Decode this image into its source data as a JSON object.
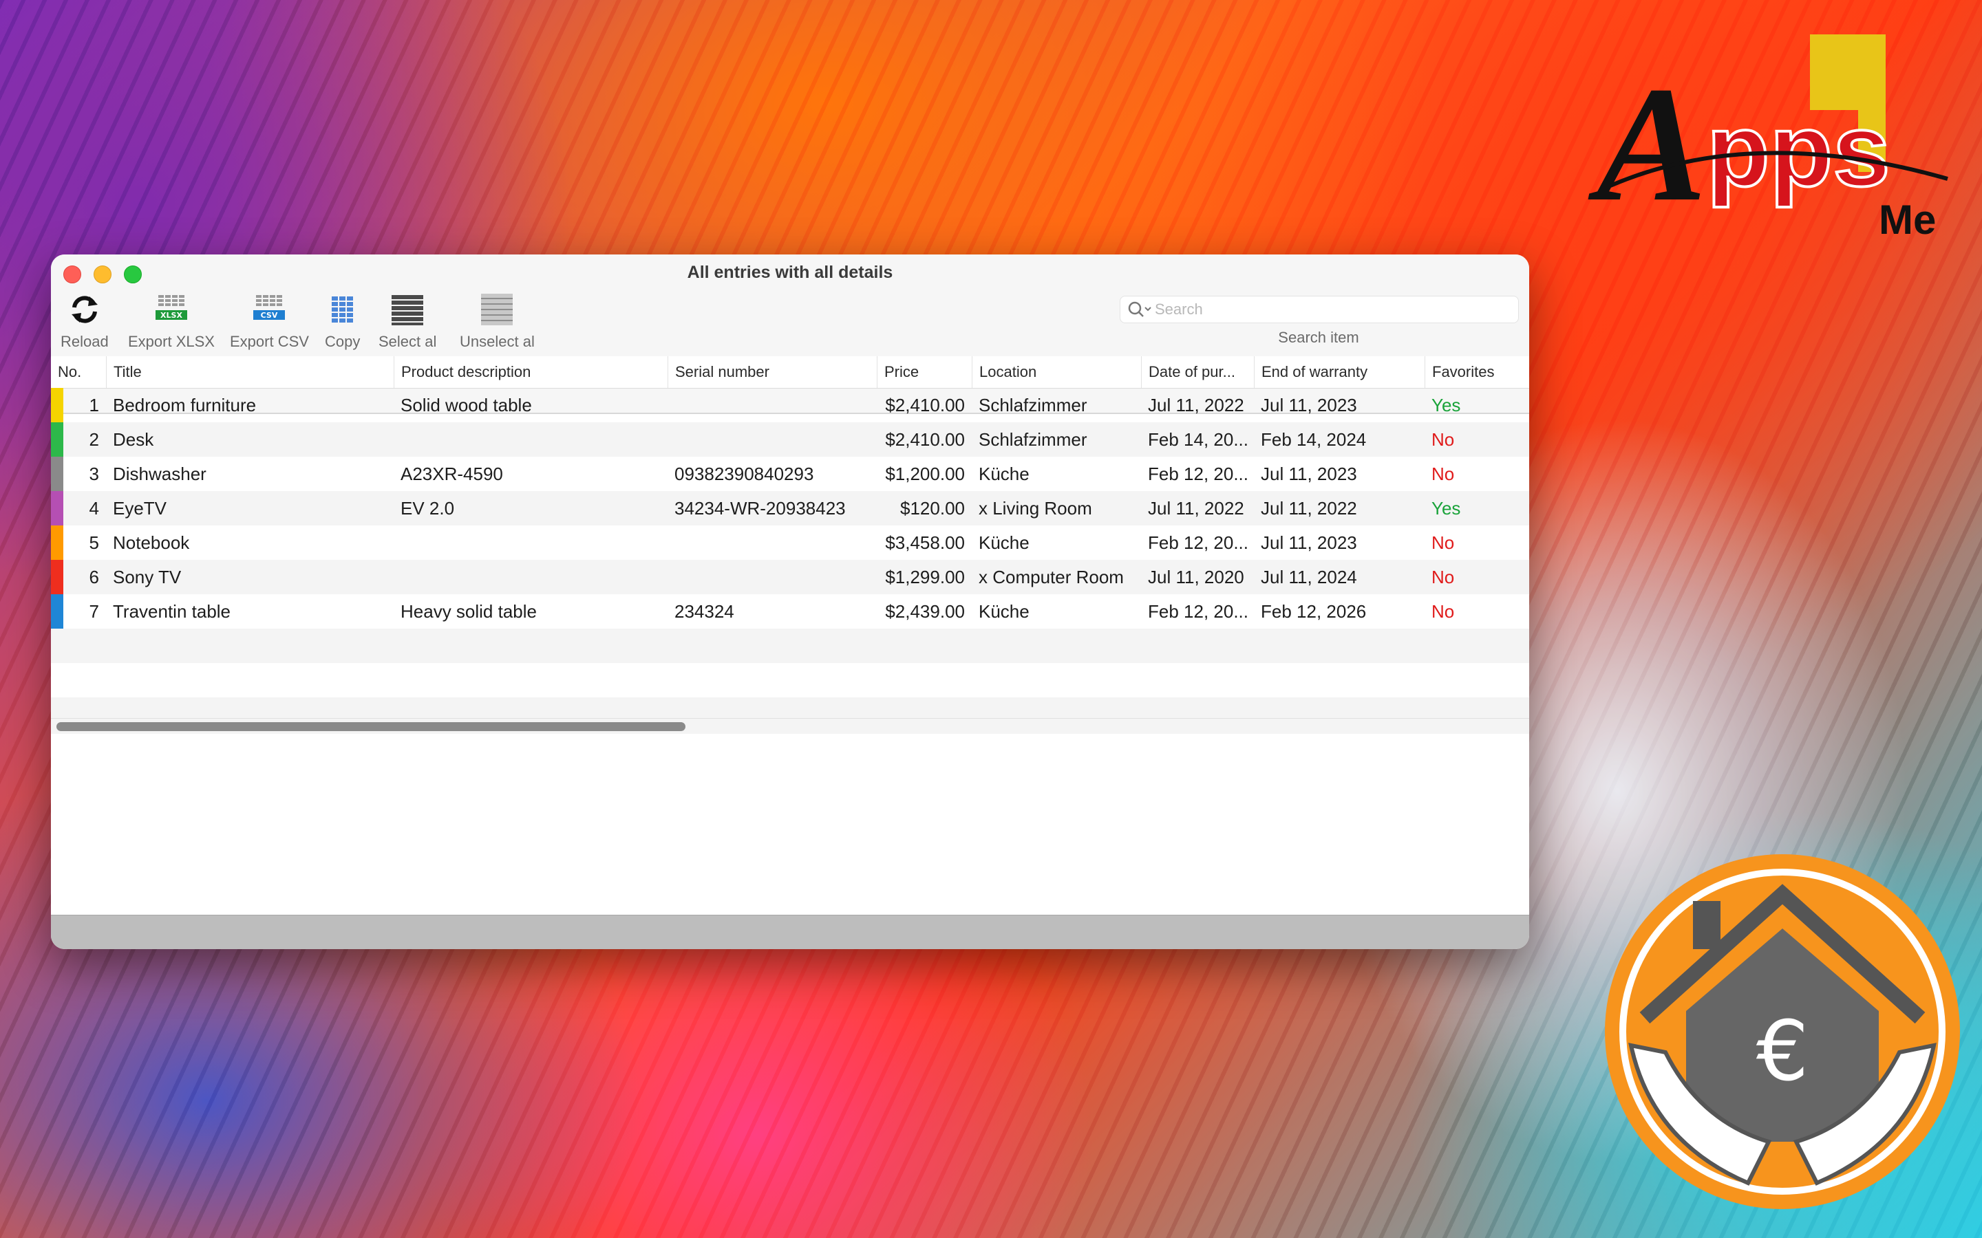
{
  "window": {
    "title": "All entries with all details"
  },
  "toolbar": {
    "reload": "Reload",
    "export_xlsx": "Export XLSX",
    "export_csv": "Export CSV",
    "copy": "Copy",
    "select_all": "Select al",
    "unselect_all": "Unselect al",
    "xlsx_tag": "XLSX",
    "csv_tag": "CSV"
  },
  "search": {
    "placeholder": "Search",
    "label": "Search item"
  },
  "table": {
    "columns": [
      "No.",
      "Title",
      "Product description",
      "Serial number",
      "Price",
      "Location",
      "Date of pur...",
      "End of warranty",
      "Favorites"
    ],
    "rows": [
      {
        "no": "1",
        "title": "Bedroom furniture",
        "desc": "Solid wood table",
        "serial": "",
        "price": "$2,410.00",
        "location": "Schlafzimmer",
        "purchase": "Jul 11, 2022",
        "warranty": "Jul 11, 2023",
        "fav": "Yes",
        "color": "#f5d400"
      },
      {
        "no": "2",
        "title": "Desk",
        "desc": "",
        "serial": "",
        "price": "$2,410.00",
        "location": "Schlafzimmer",
        "purchase": "Feb 14, 20...",
        "warranty": "Feb 14, 2024",
        "fav": "No",
        "color": "#2db84a"
      },
      {
        "no": "3",
        "title": "Dishwasher",
        "desc": "A23XR-4590",
        "serial": "09382390840293",
        "price": "$1,200.00",
        "location": "Küche",
        "purchase": "Feb 12, 20...",
        "warranty": "Jul 11, 2023",
        "fav": "No",
        "color": "#8a8a8a"
      },
      {
        "no": "4",
        "title": "EyeTV",
        "desc": "EV 2.0",
        "serial": "34234-WR-20938423",
        "price": "$120.00",
        "location": "x Living Room",
        "purchase": "Jul 11, 2022",
        "warranty": "Jul 11, 2022",
        "fav": "Yes",
        "color": "#b54fb3"
      },
      {
        "no": "5",
        "title": "Notebook",
        "desc": "",
        "serial": "",
        "price": "$3,458.00",
        "location": "Küche",
        "purchase": "Feb 12, 20...",
        "warranty": "Jul 11, 2023",
        "fav": "No",
        "color": "#ff9a00"
      },
      {
        "no": "6",
        "title": "Sony TV",
        "desc": "",
        "serial": "",
        "price": "$1,299.00",
        "location": "x Computer Room",
        "purchase": "Jul 11, 2020",
        "warranty": "Jul 11, 2024",
        "fav": "No",
        "color": "#ef2e1e"
      },
      {
        "no": "7",
        "title": "Traventin table",
        "desc": "Heavy solid table",
        "serial": "234324",
        "price": "$2,439.00",
        "location": "Küche",
        "purchase": "Feb 12, 20...",
        "warranty": "Feb 12, 2026",
        "fav": "No",
        "color": "#1f86d6"
      }
    ]
  },
  "colors": {
    "yes": "#1aa33a",
    "no": "#e01b1b",
    "accent_orange": "#f7941d"
  },
  "branding": {
    "logo_text": "Apps 4 Me",
    "house_symbol": "€"
  },
  "icons": [
    "reload-icon",
    "xlsx-icon",
    "csv-icon",
    "copy-icon",
    "select-all-icon",
    "unselect-all-icon",
    "search-icon"
  ]
}
